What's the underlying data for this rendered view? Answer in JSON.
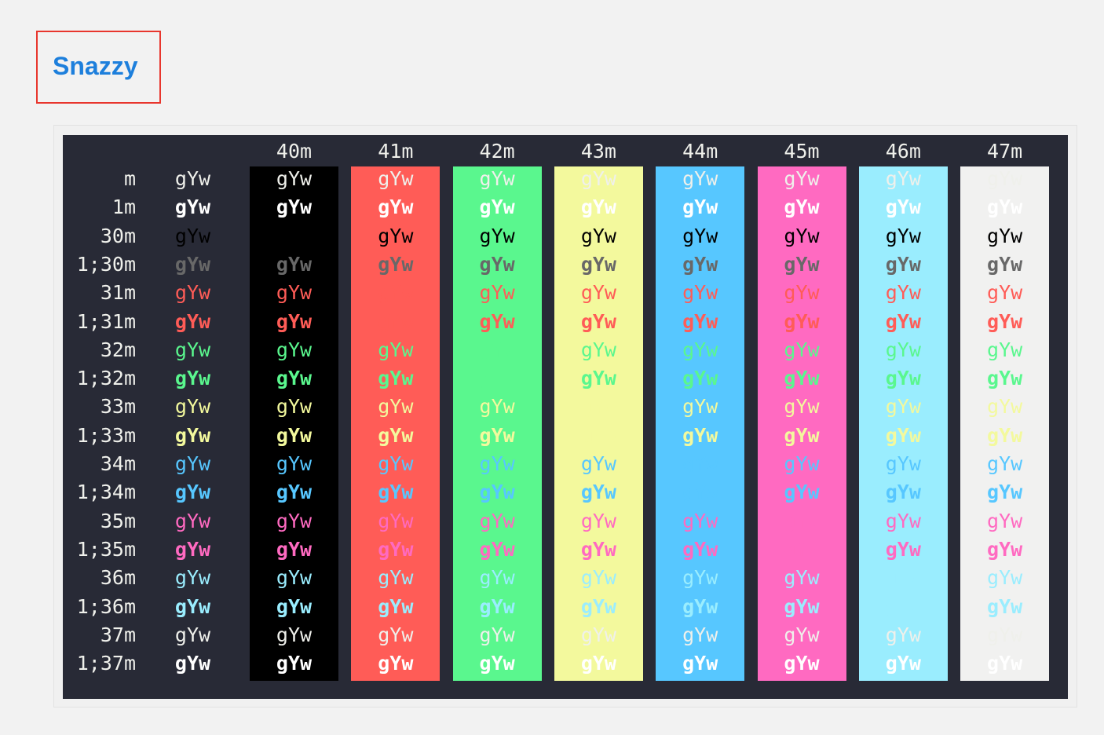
{
  "title": "Snazzy",
  "sample": "gYw",
  "headers": [
    "40m",
    "41m",
    "42m",
    "43m",
    "44m",
    "45m",
    "46m",
    "47m"
  ],
  "rows": [
    "m",
    "1m",
    "30m",
    "1;30m",
    "31m",
    "1;31m",
    "32m",
    "1;32m",
    "33m",
    "1;33m",
    "34m",
    "1;34m",
    "35m",
    "1;35m",
    "36m",
    "1;36m",
    "37m",
    "1;37m"
  ],
  "palette": {
    "terminal_bg": "#282a36",
    "fg": "#eff0eb",
    "black": "#000000",
    "bright_black": "#686868",
    "red": "#ff5c57",
    "green": "#5af78e",
    "yellow": "#f3f99d",
    "blue": "#57c7ff",
    "magenta": "#ff6ac1",
    "cyan": "#9aedfe",
    "white": "#f1f1f0",
    "title_link": "#1d7fdc",
    "title_box_border": "#e8362d"
  }
}
